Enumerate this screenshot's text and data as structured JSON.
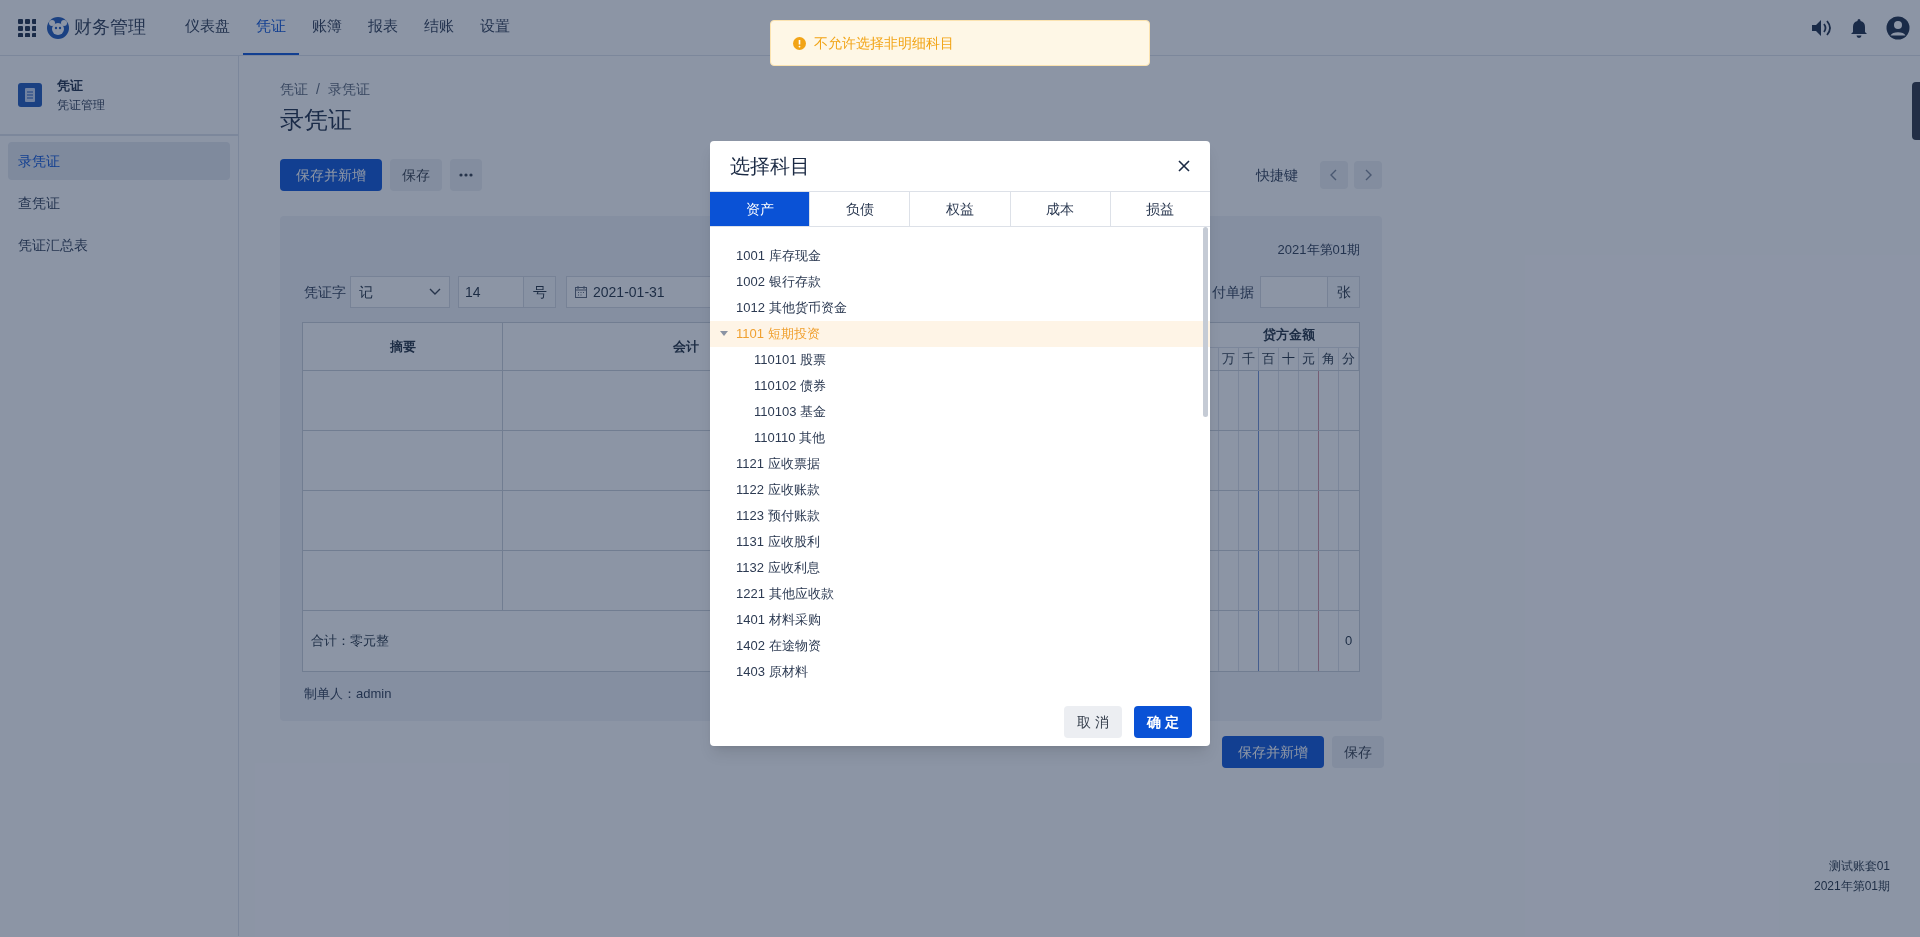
{
  "app": {
    "title": "财务管理"
  },
  "nav": [
    {
      "label": "仪表盘",
      "selected": false
    },
    {
      "label": "凭证",
      "selected": true
    },
    {
      "label": "账簿",
      "selected": false
    },
    {
      "label": "报表",
      "selected": false
    },
    {
      "label": "结账",
      "selected": false
    },
    {
      "label": "设置",
      "selected": false
    }
  ],
  "toast": {
    "kind": "warning",
    "text": "不允许选择非明细科目"
  },
  "sidebar": {
    "title": "凭证",
    "subtitle": "凭证管理",
    "items": [
      {
        "label": "录凭证",
        "selected": true
      },
      {
        "label": "查凭证",
        "selected": false
      },
      {
        "label": "凭证汇总表",
        "selected": false
      }
    ]
  },
  "breadcrumb": {
    "items": [
      "凭证",
      "录凭证"
    ],
    "separator": "/"
  },
  "page_title": "录凭证",
  "toolbar": {
    "buttons": [
      {
        "label": "保存并新增",
        "kind": "primary"
      },
      {
        "label": "保存",
        "kind": "secondary"
      }
    ],
    "shortcut_link": "快捷键"
  },
  "voucher": {
    "period": "2021年第01期",
    "word_label": "凭证字",
    "word_value": "记",
    "number": "14",
    "number_suffix": "号",
    "date": "2021-01-31",
    "attachments_label": "付单据",
    "attachments_suffix": "张",
    "columns": {
      "summary": "摘要",
      "account": "会计",
      "credit": "贷方金额",
      "credit_digits": [
        "万",
        "千",
        "百",
        "十",
        "元",
        "角",
        "分"
      ]
    },
    "total_label": "合计：零元整",
    "total_credit": "0",
    "maker": "制单人：admin"
  },
  "bottom_buttons": [
    {
      "label": "保存并新增",
      "kind": "primary"
    },
    {
      "label": "保存",
      "kind": "secondary"
    }
  ],
  "footer": {
    "account_set": "测试账套01",
    "period": "2021年第01期"
  },
  "dialog": {
    "title": "选择科目",
    "tabs": [
      {
        "label": "资产",
        "selected": true
      },
      {
        "label": "负债",
        "selected": false
      },
      {
        "label": "权益",
        "selected": false
      },
      {
        "label": "成本",
        "selected": false
      },
      {
        "label": "损益",
        "selected": false
      }
    ],
    "accounts": [
      {
        "label": "1001 库存现金",
        "selected": false
      },
      {
        "label": "1002 银行存款",
        "selected": false
      },
      {
        "label": "1012 其他货币资金",
        "selected": false
      },
      {
        "label": "1101 短期投资",
        "selected": true,
        "expanded": true,
        "children": [
          {
            "label": "110101 股票",
            "selected": false
          },
          {
            "label": "110102 债券",
            "selected": false
          },
          {
            "label": "110103 基金",
            "selected": false
          },
          {
            "label": "110110 其他",
            "selected": false
          }
        ]
      },
      {
        "label": "1121 应收票据",
        "selected": false
      },
      {
        "label": "1122 应收账款",
        "selected": false
      },
      {
        "label": "1123 预付账款",
        "selected": false
      },
      {
        "label": "1131 应收股利",
        "selected": false
      },
      {
        "label": "1132 应收利息",
        "selected": false
      },
      {
        "label": "1221 其他应收款",
        "selected": false
      },
      {
        "label": "1401 材料采购",
        "selected": false
      },
      {
        "label": "1402 在途物资",
        "selected": false
      },
      {
        "label": "1403 原材料",
        "selected": false
      }
    ],
    "buttons": [
      {
        "label": "取 消",
        "kind": "secondary"
      },
      {
        "label": "确 定",
        "kind": "primary"
      }
    ]
  }
}
